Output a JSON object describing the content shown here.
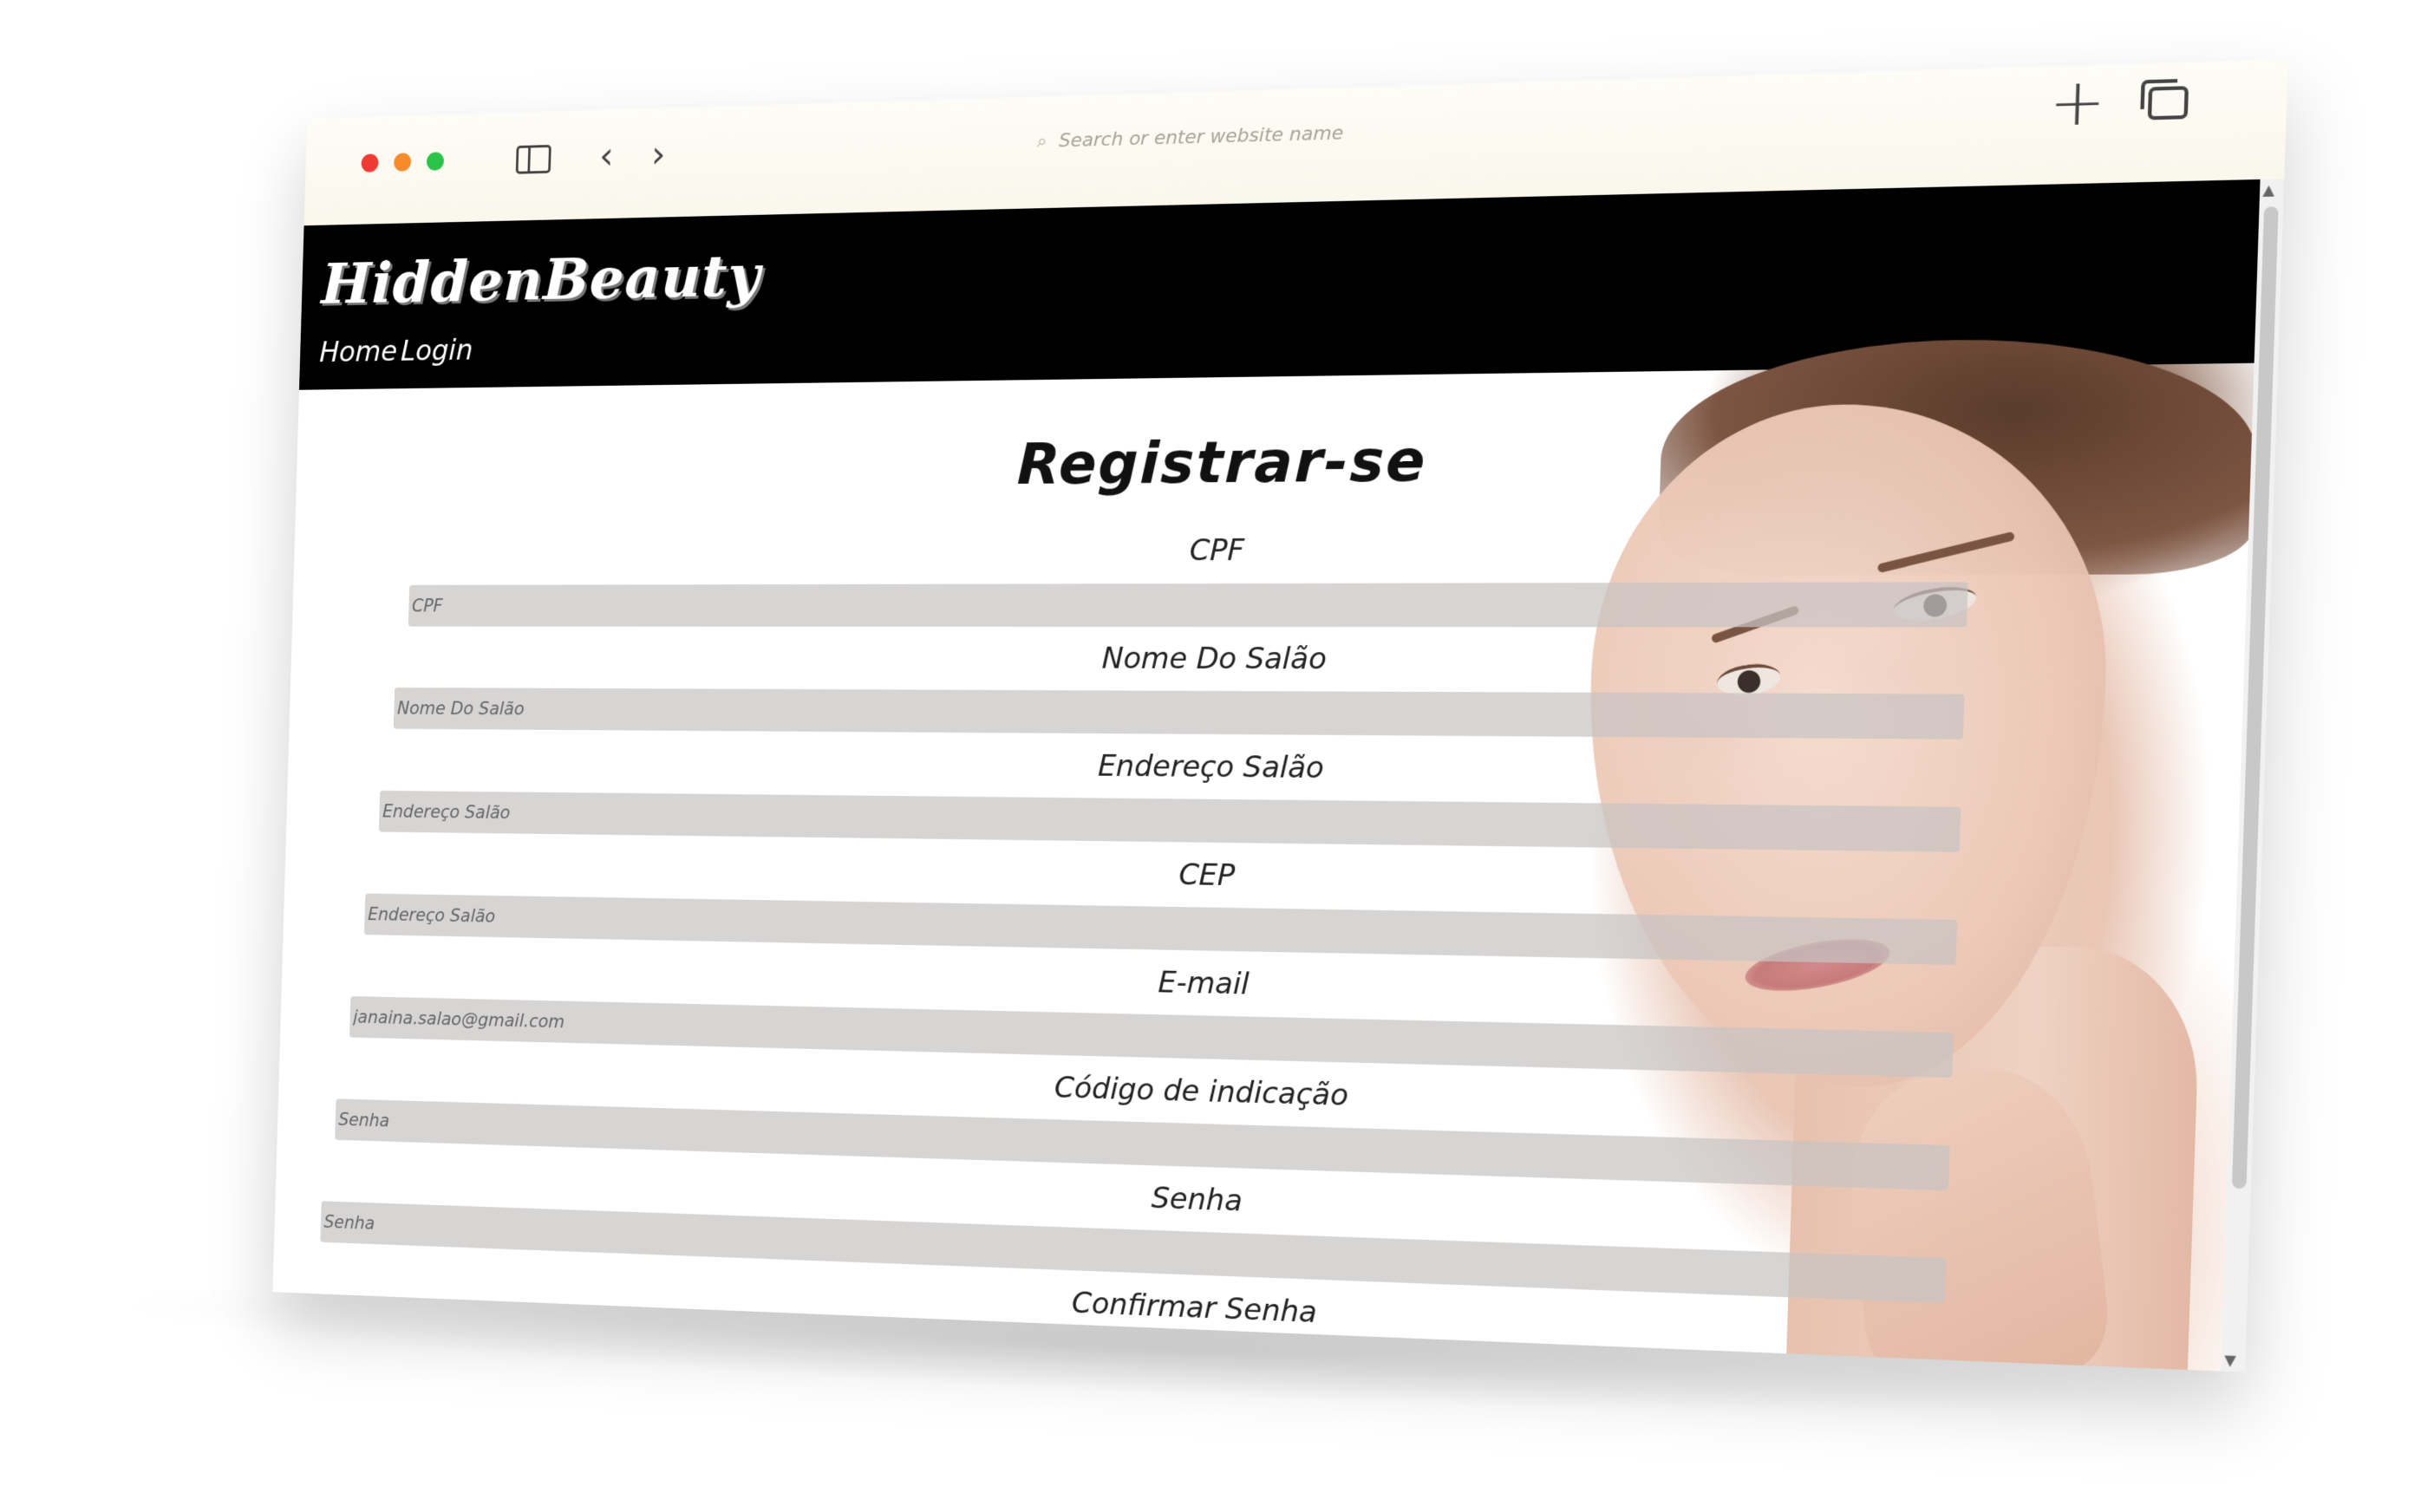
{
  "browser": {
    "address_placeholder": "Search or enter website name",
    "new_tab_symbol": "+",
    "back_symbol": "‹",
    "forward_symbol": "›"
  },
  "site": {
    "brand": "HiddenBeauty",
    "nav": {
      "home": "Home",
      "login": "Login"
    }
  },
  "form": {
    "title": "Registrar-se",
    "fields": [
      {
        "label": "CPF",
        "placeholder": "CPF"
      },
      {
        "label": "Nome Do Salão",
        "placeholder": "Nome Do Salão"
      },
      {
        "label": "Endereço Salão",
        "placeholder": "Endereço Salão"
      },
      {
        "label": "CEP",
        "placeholder": "Endereço Salão"
      },
      {
        "label": "E-mail",
        "placeholder": "janaina.salao@gmail.com"
      },
      {
        "label": "Código de indicação",
        "placeholder": "Senha"
      },
      {
        "label": "Senha",
        "placeholder": "Senha"
      },
      {
        "label": "Confirmar Senha",
        "placeholder": ""
      }
    ]
  },
  "colors": {
    "header_bg": "#000000",
    "input_bg": "#c8c4c4",
    "traffic_red": "#ee3b33",
    "traffic_orange": "#f58b2a",
    "traffic_green": "#2cc34a"
  },
  "icons": [
    "sidebar-toggle-icon",
    "back-arrow-icon",
    "forward-arrow-icon",
    "search-icon",
    "new-tab-icon",
    "tabs-overview-icon"
  ]
}
